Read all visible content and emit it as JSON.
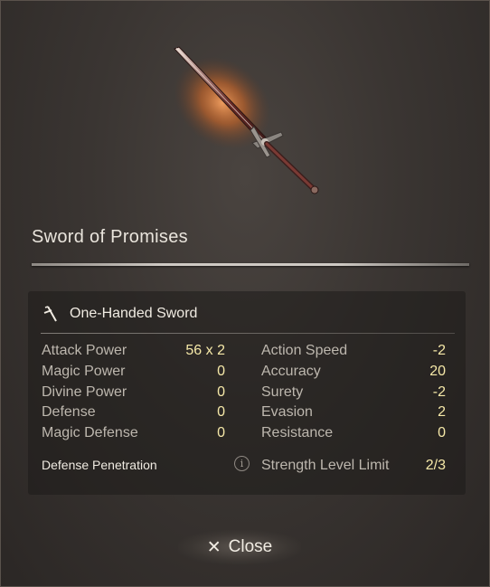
{
  "item": {
    "name": "Sword of Promises",
    "weapon_type": "One-Handed Sword"
  },
  "stats_left": [
    {
      "label": "Attack Power",
      "value": "56 x 2"
    },
    {
      "label": "Magic Power",
      "value": "0"
    },
    {
      "label": "Divine Power",
      "value": "0"
    },
    {
      "label": "Defense",
      "value": "0"
    },
    {
      "label": "Magic Defense",
      "value": "0"
    }
  ],
  "stats_right": [
    {
      "label": "Action Speed",
      "value": "-2"
    },
    {
      "label": "Accuracy",
      "value": "20"
    },
    {
      "label": "Surety",
      "value": "-2"
    },
    {
      "label": "Evasion",
      "value": "2"
    },
    {
      "label": "Resistance",
      "value": "0"
    }
  ],
  "defense_penetration": {
    "label": "Defense Penetration"
  },
  "strength_limit": {
    "label": "Strength Level Limit",
    "value": "2/3"
  },
  "icons": {
    "weapon_type": "sword-icon",
    "info": "info-icon",
    "close": "x-icon"
  },
  "close_button": {
    "x": "✕",
    "label": "Close"
  },
  "colors": {
    "value": "#f5e8a8",
    "label": "#bdb7ae",
    "glow": "#e07a30"
  }
}
